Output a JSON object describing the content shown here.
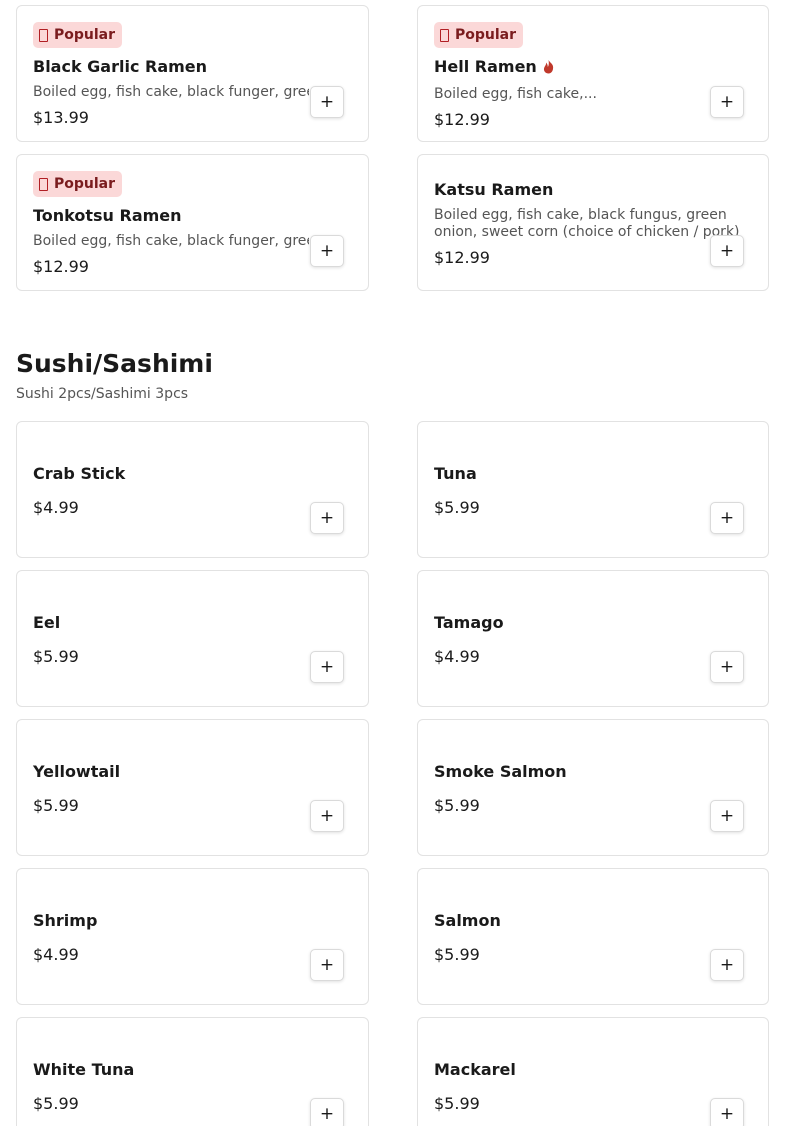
{
  "ramen": {
    "items": [
      {
        "badge": "Popular",
        "name": "Black Garlic Ramen",
        "desc": "Boiled egg, fish cake, black funger, green onion, sweet corn",
        "price": "$13.99",
        "add": "+"
      },
      {
        "badge": "Popular",
        "name": "Hell Ramen",
        "desc": "Boiled egg, fish cake,...",
        "price": "$12.99",
        "add": "+",
        "spicy_icon": "chili-pepper-icon"
      },
      {
        "badge": "Popular",
        "name": "Tonkotsu Ramen",
        "desc": "Boiled egg, fish cake, black funger, green onion, sweet corn",
        "price": "$12.99",
        "add": "+"
      },
      {
        "name": "Katsu Ramen",
        "desc": "Boiled egg, fish cake, black fungus, green onion, sweet corn (choice of chicken / pork)",
        "price": "$12.99",
        "add": "+"
      }
    ],
    "badge_icon": "fire-icon"
  },
  "sushi": {
    "title": "Sushi/Sashimi",
    "subtitle": "Sushi 2pcs/Sashimi 3pcs",
    "items": [
      {
        "name": "Crab Stick",
        "price": "$4.99",
        "add": "+"
      },
      {
        "name": "Tuna",
        "price": "$5.99",
        "add": "+"
      },
      {
        "name": "Eel",
        "price": "$5.99",
        "add": "+"
      },
      {
        "name": "Tamago",
        "price": "$4.99",
        "add": "+"
      },
      {
        "name": "Yellowtail",
        "price": "$5.99",
        "add": "+"
      },
      {
        "name": "Smoke Salmon",
        "price": "$5.99",
        "add": "+"
      },
      {
        "name": "Shrimp",
        "price": "$4.99",
        "add": "+"
      },
      {
        "name": "Salmon",
        "price": "$5.99",
        "add": "+"
      },
      {
        "name": "White Tuna",
        "price": "$5.99",
        "add": "+"
      },
      {
        "name": "Mackarel",
        "price": "$5.99",
        "add": "+"
      }
    ]
  },
  "colors": {
    "badge_bg": "#fbd8d8",
    "badge_text": "#b11f24",
    "spicy": "#c0392b"
  }
}
